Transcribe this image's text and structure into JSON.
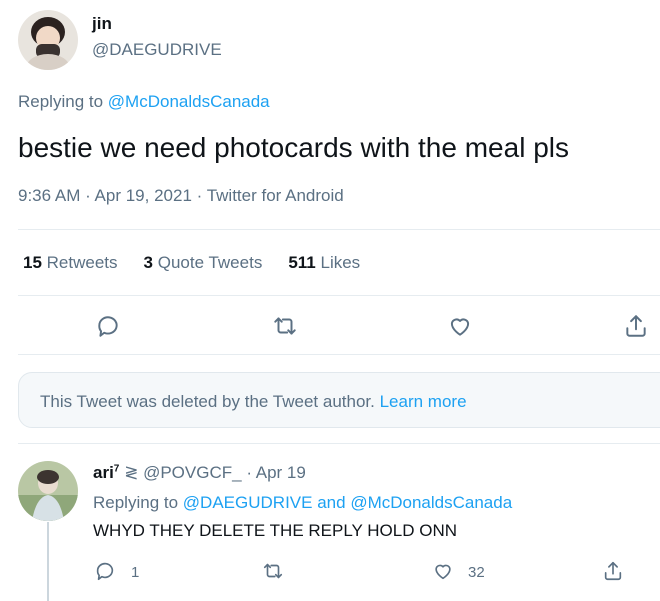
{
  "tweet": {
    "author_name": "jin",
    "author_handle": "@DAEGUDRIVE",
    "replying_prefix": "Replying to",
    "replying_to": "@McDonaldsCanada",
    "text": "bestie we need photocards with the meal pls",
    "timestamp": "9:36 AM · Apr 19, 2021 · Twitter for Android",
    "stats": {
      "retweets_count": "15",
      "retweets_label": "Retweets",
      "quotes_count": "3",
      "quotes_label": "Quote Tweets",
      "likes_count": "511",
      "likes_label": "Likes"
    }
  },
  "deleted_notice": {
    "text": "This Tweet was deleted by the Tweet author.",
    "learn_more": "Learn more"
  },
  "reply": {
    "name": "ari",
    "name_sup": "7",
    "symbol": "≷",
    "handle": "@POVGCF_",
    "date": "· Apr 19",
    "replying_prefix": "Replying to",
    "replying_user1": "@DAEGUDRIVE",
    "replying_and": "and",
    "replying_user2": "@McDonaldsCanada",
    "text": "WHYD THEY DELETE THE REPLY HOLD ONN",
    "reply_count": "1",
    "like_count": "32"
  },
  "icons": {
    "reply": "reply-icon",
    "retweet": "retweet-icon",
    "like": "heart-icon",
    "share": "share-icon"
  },
  "colors": {
    "link": "#1da1f2",
    "secondary": "#5b7083",
    "primary_text": "#0f1419",
    "divider": "#e6ecf0",
    "deleted_bg": "#f5f8fa"
  }
}
